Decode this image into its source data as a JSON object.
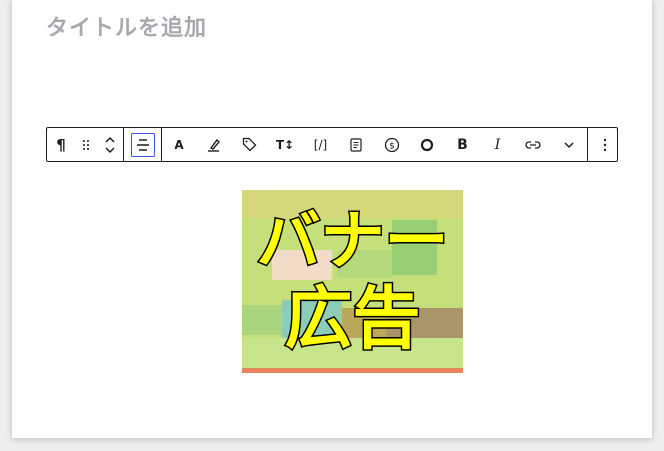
{
  "editor": {
    "title_placeholder": "タイトルを追加"
  },
  "toolbar": {
    "paragraph_icon": "pilcrow-icon",
    "items": [
      {
        "name": "highlight",
        "icon": "highlighter-icon"
      },
      {
        "name": "tag",
        "icon": "tag-icon"
      },
      {
        "name": "text-size",
        "icon": "text-size-icon",
        "label": "T↕"
      },
      {
        "name": "inline-code",
        "icon": "code-icon",
        "label": "[/]"
      },
      {
        "name": "document",
        "icon": "document-icon"
      },
      {
        "name": "currency",
        "icon": "dollar-circle-icon"
      },
      {
        "name": "circle",
        "icon": "circle-icon"
      }
    ],
    "font_label": "A",
    "bold_label": "B",
    "italic_label": "I"
  },
  "banner": {
    "line1": "バナー",
    "line2": "広告",
    "colors": {
      "text": "#ffff00",
      "outline": "#000000",
      "stripe": "#e8845c"
    }
  },
  "colors": {
    "accent": "#3858e9",
    "border": "#1e1e1e",
    "title": "#a7aaad"
  }
}
